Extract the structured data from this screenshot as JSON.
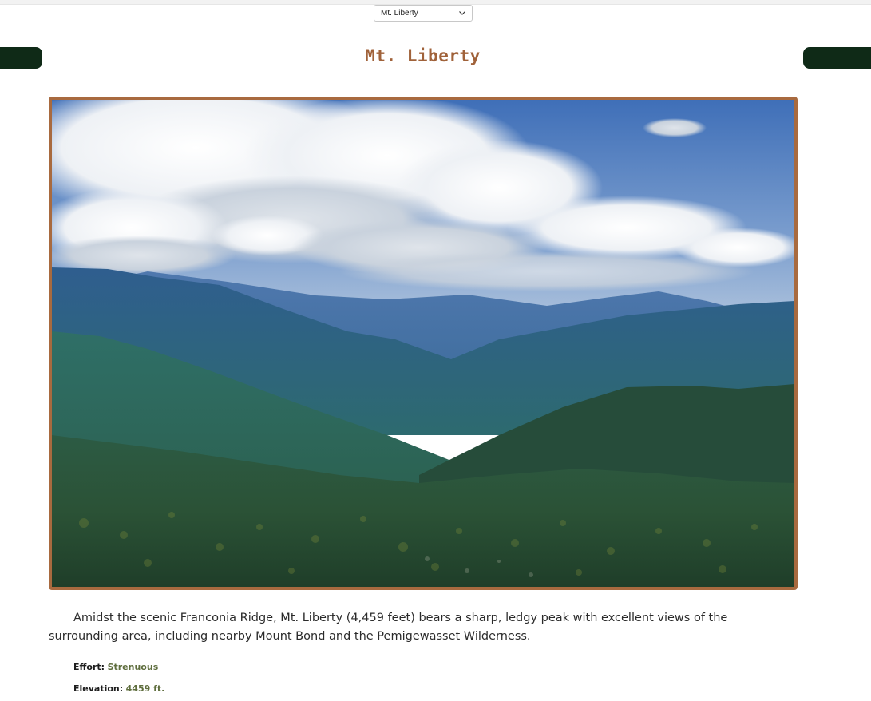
{
  "mountain_select": {
    "selected": "Mt. Liberty"
  },
  "page_title": "Mt. Liberty",
  "photo": {
    "subject": "mountain-ridge-landscape"
  },
  "description": "Amidst the scenic Franconia Ridge, Mt. Liberty (4,459 feet) bears a sharp, ledgy peak with excellent views of the surrounding area, including nearby Mount Bond and the Pemigewasset Wilderness.",
  "facts": {
    "effort_label": "Effort:",
    "effort_value": "Strenuous",
    "elevation_label": "Elevation:",
    "elevation_value": "4459 ft."
  },
  "colors": {
    "title": "#a0623a",
    "nav_button": "#0f2a17",
    "frame": "#a86a3f",
    "fact_value": "#5f6e3e"
  },
  "icons": {
    "select_arrow": "chevron-down-icon"
  }
}
